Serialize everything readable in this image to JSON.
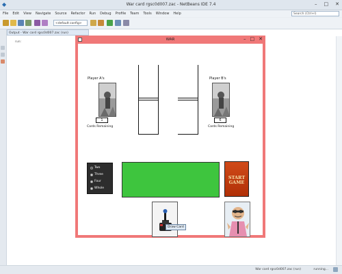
{
  "ide": {
    "window_title": "War card rgsc0d007.zac - NetBeans IDE 7.4",
    "menus": [
      "File",
      "Edit",
      "View",
      "Navigate",
      "Source",
      "Refactor",
      "Run",
      "Debug",
      "Profile",
      "Team",
      "Tools",
      "Window",
      "Help"
    ],
    "search_placeholder": "Search (Ctrl+I)",
    "config_select": "<default config>",
    "editor_tab": "Output - War card rgsc0d007.zac (run)",
    "output_line": "run:",
    "status_text": "War card rgsc0d007.zac (run)",
    "status_pos": "running...",
    "icons": {
      "logo": "netbeans-logo-icon",
      "new_project": "new-project-icon",
      "open": "open-project-icon",
      "save": "save-all-icon",
      "undo": "undo-icon",
      "redo": "redo-icon",
      "run": "run-icon",
      "debug": "debug-icon",
      "profile": "profile-icon"
    },
    "colors": {
      "accent": "#2a6db0",
      "game_window_border": "#f07878",
      "board_green": "#3ec53e"
    }
  },
  "game": {
    "title": "WAR",
    "player_a_label": "Player A's",
    "player_b_label": "Player B's",
    "player_a_count": "1",
    "player_b_count": "6",
    "cards_remaining_label": "Cards Remaining",
    "options": [
      "Two",
      "Three",
      "Four",
      "Whole"
    ],
    "selected_option": "Two",
    "start_label_line1": "START",
    "start_label_line2": "GAME",
    "tooltip": "Draw Card"
  }
}
